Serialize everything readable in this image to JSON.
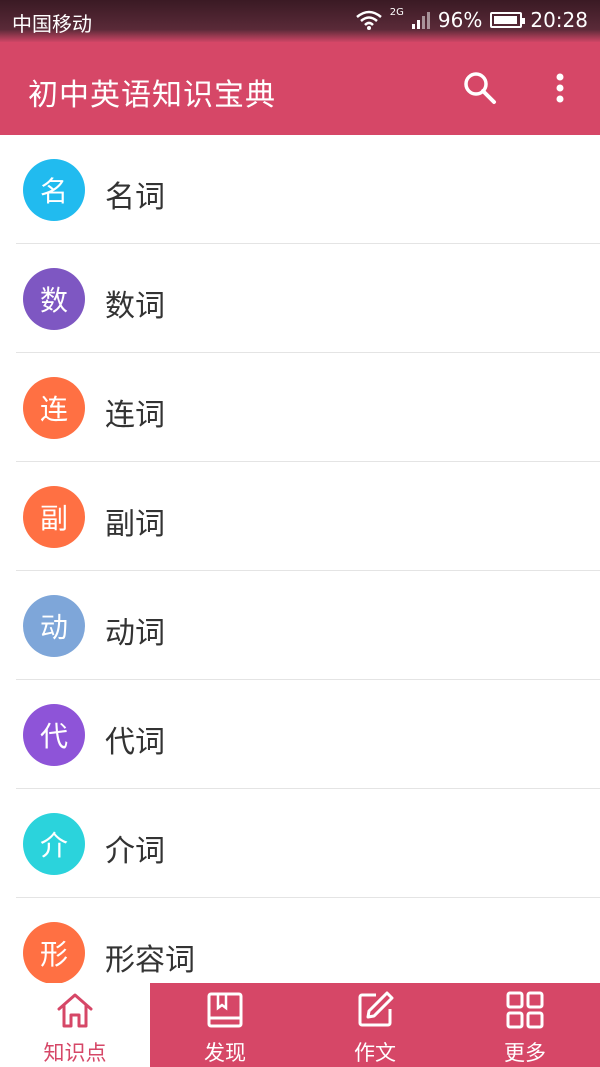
{
  "status": {
    "carrier": "中国移动",
    "network": "2G",
    "battery_pct": "96%",
    "battery_level": 0.96,
    "time": "20:28"
  },
  "appbar": {
    "title": "初中英语知识宝典",
    "search_icon": "search-icon",
    "more_icon": "more-vert-icon"
  },
  "items": [
    {
      "badge": "名",
      "label": "名词",
      "color": "#21bbef"
    },
    {
      "badge": "数",
      "label": "数词",
      "color": "#7e57c2"
    },
    {
      "badge": "连",
      "label": "连词",
      "color": "#ff7043"
    },
    {
      "badge": "副",
      "label": "副词",
      "color": "#ff7043"
    },
    {
      "badge": "动",
      "label": "动词",
      "color": "#7ea6d9"
    },
    {
      "badge": "代",
      "label": "代词",
      "color": "#8e54d8"
    },
    {
      "badge": "介",
      "label": "介词",
      "color": "#2bd3dc"
    },
    {
      "badge": "形",
      "label": "形容词",
      "color": "#ff7043"
    }
  ],
  "tabs": [
    {
      "label": "知识点",
      "icon": "home-icon",
      "active": true
    },
    {
      "label": "发现",
      "icon": "book-icon",
      "active": false
    },
    {
      "label": "作文",
      "icon": "edit-icon",
      "active": false
    },
    {
      "label": "更多",
      "icon": "grid-icon",
      "active": false
    }
  ],
  "colors": {
    "primary": "#d64767",
    "text": "#333333",
    "divider": "#e4e4e4"
  }
}
